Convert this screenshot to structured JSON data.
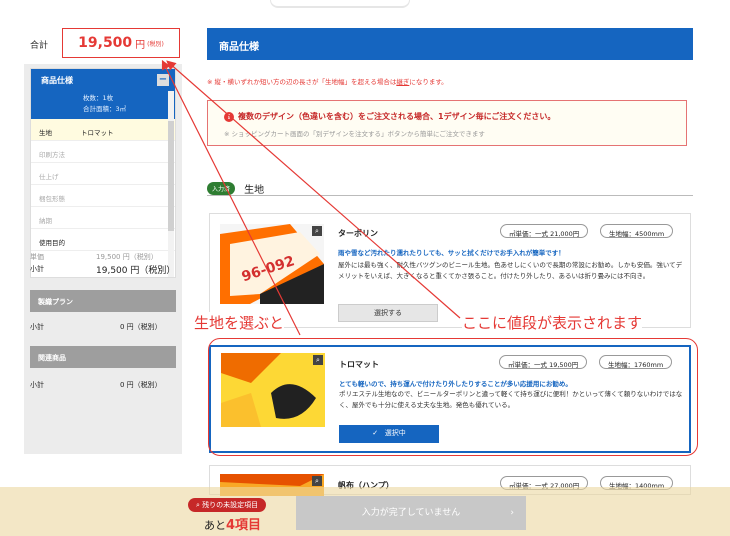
{
  "sidebar": {
    "total_label": "合計",
    "total_price": "19,500",
    "total_unit": "円",
    "total_tax": "(税別)",
    "spec_title": "商品仕様",
    "sub_lines": [
      "枚数：1枚",
      "合計面積：3㎡"
    ],
    "rows": [
      {
        "label": "生地",
        "value": "トロマット",
        "selected": true
      },
      {
        "label": "印刷方法",
        "value": ""
      },
      {
        "label": "仕上げ",
        "value": ""
      },
      {
        "label": "梱包形態",
        "value": ""
      },
      {
        "label": "納期",
        "value": ""
      },
      {
        "label": "使用目的",
        "value": ""
      }
    ],
    "unit_label": "単価",
    "unit_value": "19,500 円（税別）",
    "subtotal_label": "小計",
    "subtotal_value": "19,500 円（税別）",
    "plan_title": "製織プラン",
    "plan_subtotal_label": "小計",
    "plan_subtotal_value": "0 円（税別）",
    "related_title": "関連商品",
    "related_subtotal_label": "小計",
    "related_subtotal_value": "0 円（税別）"
  },
  "main": {
    "header": "商品仕様",
    "note_prefix": "※ 縦・横いずれか短い方の辺の長さが「生地幅」を超える場合は",
    "note_link": "継ぎ",
    "note_suffix": "になります。",
    "alert_title": "複数のデザイン（色違いを含む）をご注文される場合、1デザイン毎にご注文ください。",
    "alert_sub": "※ ショッピングカート画面の「別デザインを注文する」ボタンから簡単にご注文できます",
    "section_badge": "入力済",
    "section_title": "生地",
    "cards": [
      {
        "name": "ターポリン",
        "price": "㎡単価：一式 21,000円",
        "width": "生地幅：4500mm",
        "lead": "雨や雪など汚れたり濡れたりしても、サッと拭くだけでお手入れが簡単です！",
        "desc": "屋外には最も強く、耐久性バツグンのビニール生地。色あせしにくいので長期の常設にお勧め。しかも安価。強いてデメリットをいえば、大きくなると重くてかさ張ること。付けたり外したり、あるいは折り畳みには不向き。",
        "button": "選択する"
      },
      {
        "name": "トロマット",
        "price": "㎡単価：一式 19,500円",
        "width": "生地幅：1760mm",
        "lead": "とても軽いので、持ち運んで付けたり外したりすることが多い応援用にお勧め。",
        "desc": "ポリエステル生地なので、ビニールターポリンと違って軽くて持ち運びに便利！かといって薄くて頼りないわけではなく、屋外でも十分に使える丈夫な生地。発色も優れている。",
        "button": "選択中"
      },
      {
        "name": "帆布（ハンプ）",
        "price": "㎡単価：一式 27,000円",
        "width": "生地幅：1400mm"
      }
    ]
  },
  "annotations": {
    "left": "生地を選ぶと",
    "right": "ここに値段が表示されます"
  },
  "bottom": {
    "remain_badge": "残りの未設定項目",
    "remain_prefix": "あと",
    "remain_count": "4項目",
    "button": "入力が完了していません"
  },
  "colors": {
    "brand": "#1565c0",
    "accent": "#e53935"
  }
}
